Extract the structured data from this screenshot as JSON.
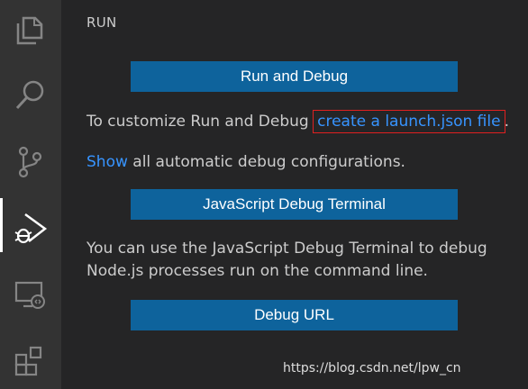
{
  "sidebar": {
    "title": "RUN",
    "run_debug_button": "Run and Debug",
    "customize_text": "To customize Run and Debug ",
    "launch_link": "create a launch.json file",
    "period": ".",
    "show_link": "Show",
    "show_text": " all automatic debug configurations.",
    "js_terminal_button": "JavaScript Debug Terminal",
    "terminal_text_line1": "You can use the JavaScript Debug Terminal to debug",
    "terminal_text_line2": "Node.js processes run on the command line.",
    "debug_url_button": "Debug URL"
  },
  "activity_bar": {
    "items": [
      "explorer-icon",
      "search-icon",
      "source-control-icon",
      "run-debug-icon",
      "remote-explorer-icon",
      "extensions-icon"
    ]
  },
  "watermark": "https://blog.csdn.net/lpw_cn",
  "colors": {
    "button": "#0e639c",
    "link": "#3794ff",
    "highlight": "#e02020"
  }
}
